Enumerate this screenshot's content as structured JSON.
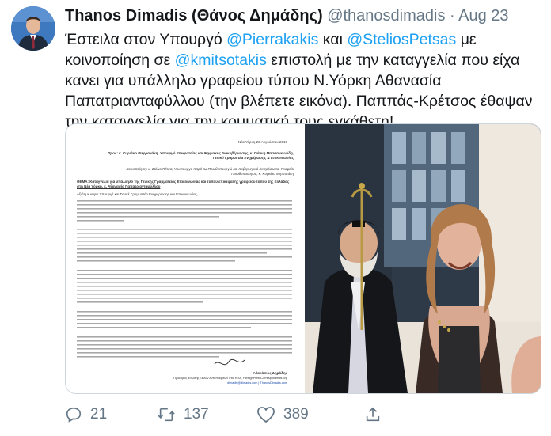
{
  "tweet": {
    "display_name": "Thanos Dimadis (Θάνος Δημάδης)",
    "handle": "@thanosdimadis",
    "separator": "·",
    "date": "Aug 23",
    "text_parts": [
      {
        "text": "Έστειλα στον Υπουργό ",
        "mention": false
      },
      {
        "text": "@Pierrakakis",
        "mention": true
      },
      {
        "text": " και ",
        "mention": false
      },
      {
        "text": "@SteliosPetsas",
        "mention": true
      },
      {
        "text": " με κοινοποίηση σε ",
        "mention": false
      },
      {
        "text": "@kmitsotakis",
        "mention": true
      },
      {
        "text": " επιστολή με την καταγγελία που είχα κανει για υπάλληλο γραφείου τύπου Ν.Υόρκη Αθανασία Παπατριανταφύλλου (την βλέπετε εικόνα). Παππάς-Κρέτσος έθαψαν την καταγγελία για την κομματική τους εγκάθετη!",
        "mention": false
      }
    ]
  },
  "media": {
    "letter": {
      "date_line": "Νέα Υόρκη 23 Αυγούστου 2019",
      "to_line": "Προς: κ. Κυριάκο Πιερρακάκη, Υπουργό Επικρατείας και Ψηφιακής Διακυβέρνησης, κ. Γιάννη Μασσαγκωνίδη, Γενικό Γραμματέα Ενημέρωσης & Επικοινωνίας",
      "cc_line": "Κοινοποίηση: κ. Στέλιο Πέτσα, Υφυπουργό παρά τω Πρωθυπουργώ και Κυβερνητικό Εκπρόσωπο, Γραφείο Πρωθυπουργού, κ. Κυριάκο Μητσοτάκη",
      "subject_line": "ΘΕΜΑ: Καταγγελία για υπάλληλο της Γενικής Γραμματείας Επικοινωνίας και τύπου επικεφαλής γραφείου τύπου της Ελλάδας στη Νέα Υόρκη, κ. Αθανασία Παπατριανταφύλλου",
      "salutation": "Αξιότιμε κύριε Υπουργέ και Γενικέ Γραμματέα Ενημέρωσης και Επικοινωνίας,",
      "signature_name": "Αθανάσιος Δημάδης",
      "signature_title": "Πρόεδρος Ένωσης Ξένων Ανταποκριτών στις ΗΠΑ, ForeignPressCorrespondents.org",
      "signature_contact": "dimadis@dimadis.com | ThanosDimadis.com"
    }
  },
  "actions": {
    "reply_count": "21",
    "retweet_count": "137",
    "like_count": "389"
  },
  "colors": {
    "mention": "#1da1f2",
    "meta": "#657786",
    "text": "#14171a",
    "border": "#ccd6dd"
  },
  "icons": [
    "avatar",
    "reply-icon",
    "retweet-icon",
    "like-icon",
    "share-icon"
  ]
}
